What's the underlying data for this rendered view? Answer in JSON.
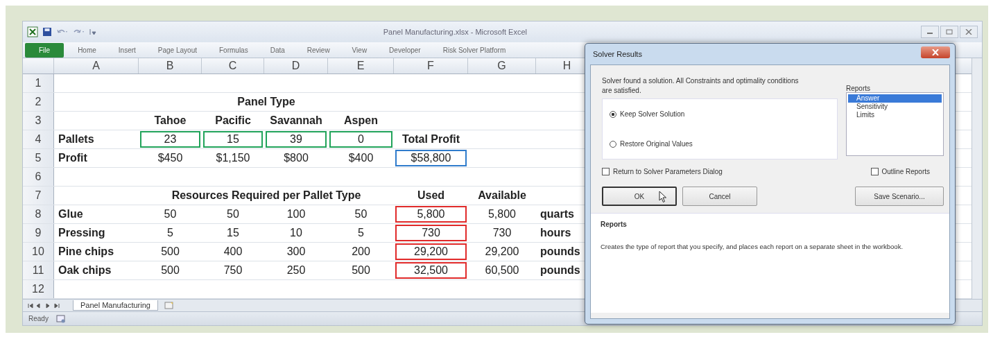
{
  "window": {
    "title": "Panel Manufacturing.xlsx - Microsoft Excel"
  },
  "ribbon_tabs": [
    {
      "label": "File",
      "kind": "file"
    },
    {
      "label": "Home",
      "kind": "tab"
    },
    {
      "label": "Insert",
      "kind": "tab"
    },
    {
      "label": "Page Layout",
      "kind": "tab"
    },
    {
      "label": "Formulas",
      "kind": "tab"
    },
    {
      "label": "Data",
      "kind": "tab"
    },
    {
      "label": "Review",
      "kind": "tab"
    },
    {
      "label": "View",
      "kind": "tab"
    },
    {
      "label": "Developer",
      "kind": "tab"
    },
    {
      "label": "Risk Solver Platform",
      "kind": "tab"
    }
  ],
  "columns": [
    "A",
    "B",
    "C",
    "D",
    "E",
    "F",
    "G",
    "H"
  ],
  "rows": [
    {
      "number": "1"
    },
    {
      "number": "2",
      "cells": {
        "B": {
          "text": "Panel Type",
          "bold": true,
          "merged": true
        }
      }
    },
    {
      "number": "3",
      "cells": {
        "B": {
          "text": "Tahoe",
          "bold": true
        },
        "C": {
          "text": "Pacific",
          "bold": true
        },
        "D": {
          "text": "Savannah",
          "bold": true
        },
        "E": {
          "text": "Aspen",
          "bold": true
        }
      }
    },
    {
      "number": "4",
      "cells": {
        "A": {
          "text": "Pallets",
          "bold": true
        },
        "B": {
          "text": "23",
          "bold": false,
          "color": "#21a35a"
        },
        "C": {
          "text": "15",
          "bold": false,
          "color": "#21a35a"
        },
        "D": {
          "text": "39",
          "bold": false,
          "color": "#21a35a"
        },
        "E": {
          "text": "0",
          "bold": false,
          "color": "#21a35a"
        },
        "F": {
          "text": "Total Profit",
          "bold": true
        }
      }
    },
    {
      "number": "5",
      "cells": {
        "A": {
          "text": "Profit",
          "bold": true
        },
        "B": {
          "text": "$450",
          "bold": false
        },
        "C": {
          "text": "$1,150",
          "bold": false
        },
        "D": {
          "text": "$800",
          "bold": false
        },
        "E": {
          "text": "$400",
          "bold": false
        },
        "F": {
          "text": "$58,800",
          "bold": false,
          "color": "#2f7ccc"
        }
      }
    },
    {
      "number": "6"
    },
    {
      "number": "7",
      "cells": {
        "B": {
          "text": "Resources Required per Pallet Type",
          "bold": true,
          "merged": true
        },
        "F": {
          "text": "Used",
          "bold": true
        },
        "G": {
          "text": "Available",
          "bold": true
        }
      }
    },
    {
      "number": "8",
      "cells": {
        "A": {
          "text": "Glue",
          "bold": true
        },
        "B": {
          "text": "50",
          "bold": false
        },
        "C": {
          "text": "50",
          "bold": false
        },
        "D": {
          "text": "100",
          "bold": false
        },
        "E": {
          "text": "50",
          "bold": false
        },
        "F": {
          "text": "5,800",
          "bold": false,
          "color": "#e02a2a"
        },
        "G": {
          "text": "5,800",
          "bold": false
        },
        "H": {
          "text": "quarts",
          "bold": true
        }
      }
    },
    {
      "number": "9",
      "cells": {
        "A": {
          "text": "Pressing",
          "bold": true
        },
        "B": {
          "text": "5",
          "bold": false
        },
        "C": {
          "text": "15",
          "bold": false
        },
        "D": {
          "text": "10",
          "bold": false
        },
        "E": {
          "text": "5",
          "bold": false
        },
        "F": {
          "text": "730",
          "bold": false,
          "color": "#e02a2a"
        },
        "G": {
          "text": "730",
          "bold": false
        },
        "H": {
          "text": "hours",
          "bold": true
        }
      }
    },
    {
      "number": "10",
      "cells": {
        "A": {
          "text": "Pine chips",
          "bold": true
        },
        "B": {
          "text": "500",
          "bold": false
        },
        "C": {
          "text": "400",
          "bold": false
        },
        "D": {
          "text": "300",
          "bold": false
        },
        "E": {
          "text": "200",
          "bold": false
        },
        "F": {
          "text": "29,200",
          "bold": false,
          "color": "#e02a2a"
        },
        "G": {
          "text": "29,200",
          "bold": false
        },
        "H": {
          "text": "pounds",
          "bold": true
        }
      }
    },
    {
      "number": "11",
      "cells": {
        "A": {
          "text": "Oak chips",
          "bold": true
        },
        "B": {
          "text": "500",
          "bold": false
        },
        "C": {
          "text": "750",
          "bold": false
        },
        "D": {
          "text": "250",
          "bold": false
        },
        "E": {
          "text": "500",
          "bold": false
        },
        "F": {
          "text": "32,500",
          "bold": false,
          "color": "#e02a2a"
        },
        "G": {
          "text": "60,500",
          "bold": false
        },
        "H": {
          "text": "pounds",
          "bold": true
        }
      }
    },
    {
      "number": "12"
    }
  ],
  "sheet_tabs": [
    {
      "label": "Panel Manufacturing",
      "selected": true
    }
  ],
  "status_bar": {
    "text": "Ready"
  },
  "dialog": {
    "title": "Solver Results",
    "message": "Solver found a solution.  All Constraints and optimality conditions are satisfied.",
    "options": [
      {
        "label": "Keep Solver Solution",
        "selected": true
      },
      {
        "label": "Restore Original Values",
        "selected": false
      }
    ],
    "reports_label": "Reports",
    "reports": [
      {
        "label": "Answer",
        "selected": true
      },
      {
        "label": "Sensitivity",
        "selected": false
      },
      {
        "label": "Limits",
        "selected": false
      }
    ],
    "checkboxes": [
      {
        "label": "Return to Solver Parameters Dialog",
        "checked": false
      },
      {
        "label": "Outline Reports",
        "checked": false
      }
    ],
    "buttons": [
      {
        "label": "OK",
        "focused": true
      },
      {
        "label": "Cancel",
        "focused": false
      },
      {
        "label": "Save Scenario...",
        "focused": false
      }
    ],
    "info": {
      "heading": "Reports",
      "text": "Creates the type of report that you specify, and places each report on a separate sheet in the workbook."
    }
  }
}
